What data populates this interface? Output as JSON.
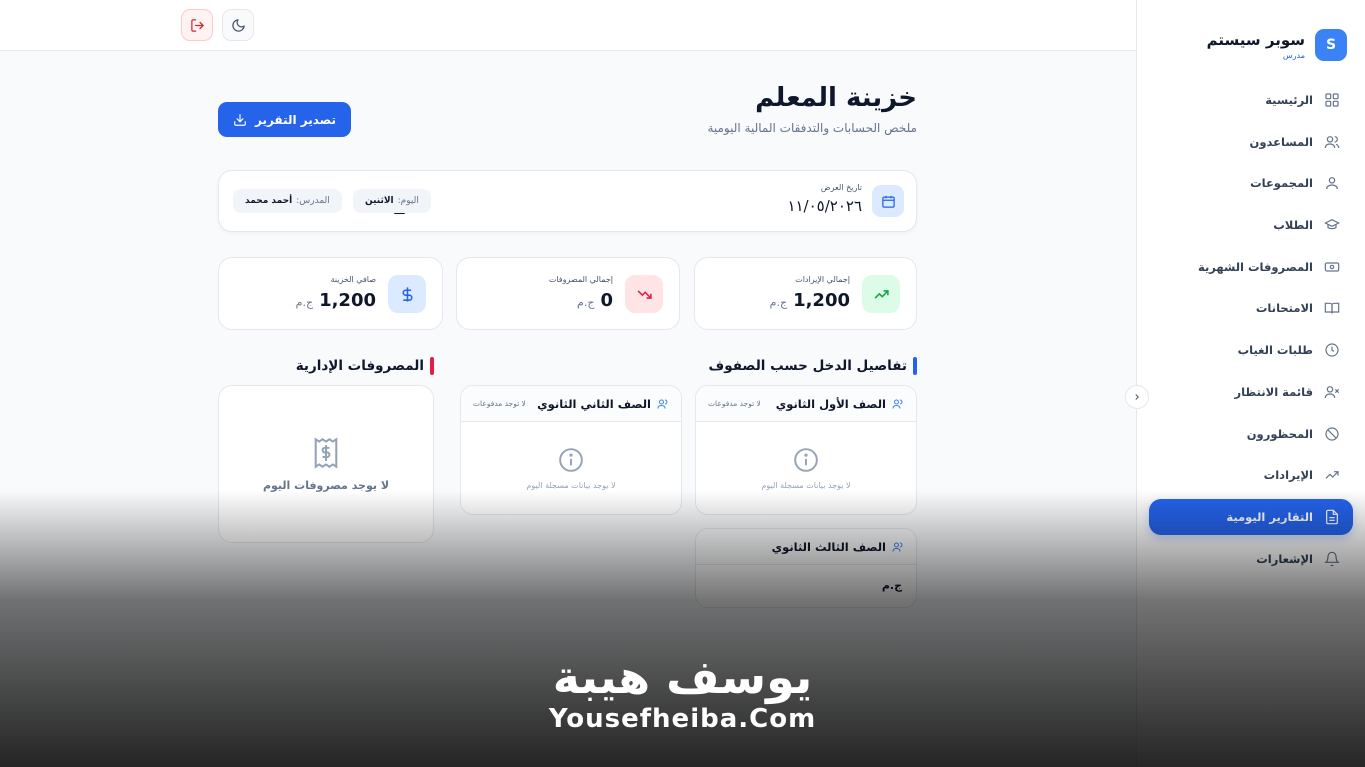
{
  "brand": {
    "logo_letter": "S",
    "name": "سوبر سيستم",
    "role": "مدرس"
  },
  "sidebar": {
    "items": [
      {
        "label": "الرئيسية",
        "icon": "grid-icon"
      },
      {
        "label": "المساعدون",
        "icon": "users-icon"
      },
      {
        "label": "المجموعات",
        "icon": "user-group-icon"
      },
      {
        "label": "الطلاب",
        "icon": "graduation-cap-icon"
      },
      {
        "label": "المصروفات الشهرية",
        "icon": "banknote-icon"
      },
      {
        "label": "الامتحانات",
        "icon": "book-open-icon"
      },
      {
        "label": "طلبات الغياب",
        "icon": "clock-icon"
      },
      {
        "label": "قائمة الانتظار",
        "icon": "user-x-icon"
      },
      {
        "label": "المحظورون",
        "icon": "ban-icon"
      },
      {
        "label": "الإيرادات",
        "icon": "trending-up-icon"
      },
      {
        "label": "التقارير اليومية",
        "icon": "file-text-icon",
        "active": true
      },
      {
        "label": "الإشعارات",
        "icon": "bell-icon"
      }
    ]
  },
  "header": {
    "title": "خزينة المعلم",
    "subtitle": "ملخص الحسابات والتدفقات المالية اليومية",
    "export_label": "تصدير التقرير"
  },
  "filter": {
    "date_label": "تاريخ العرض",
    "date_value": "١١/٠٥/٢٠٢٦",
    "day_label": "اليوم:",
    "day_value": "الاثنين",
    "teacher_label": "المدرس:",
    "teacher_value": "أحمد محمد"
  },
  "stats": [
    {
      "label": "إجمالي الإيرادات",
      "value": "1,200",
      "currency": "ج.م"
    },
    {
      "label": "إجمالي المصروفات",
      "value": "0",
      "currency": "ج.م"
    },
    {
      "label": "صافي الخزينة",
      "value": "1,200",
      "currency": "ج.م"
    }
  ],
  "income_section": {
    "title": "تفاصيل الدخل حسب الصفوف",
    "groups": [
      {
        "name": "الصف الأول الثانوي",
        "status": "لا توجد مدفوعات",
        "empty": "لا يوجد بيانات مسجلة اليوم"
      },
      {
        "name": "الصف الثاني الثانوي",
        "status": "لا توجد مدفوعات",
        "empty": "لا يوجد بيانات مسجلة اليوم"
      },
      {
        "name": "الصف الثالث الثانوي",
        "currency": "ج.م"
      }
    ]
  },
  "expenses_section": {
    "title": "المصروفات الإدارية",
    "empty": "لا يوجد مصروفات اليوم"
  },
  "watermark": {
    "arabic": "يوسف هيبة",
    "english": "Yousefheiba.Com"
  },
  "colors": {
    "primary": "#2563eb",
    "income": "#16a34a",
    "expense": "#e11d48"
  }
}
